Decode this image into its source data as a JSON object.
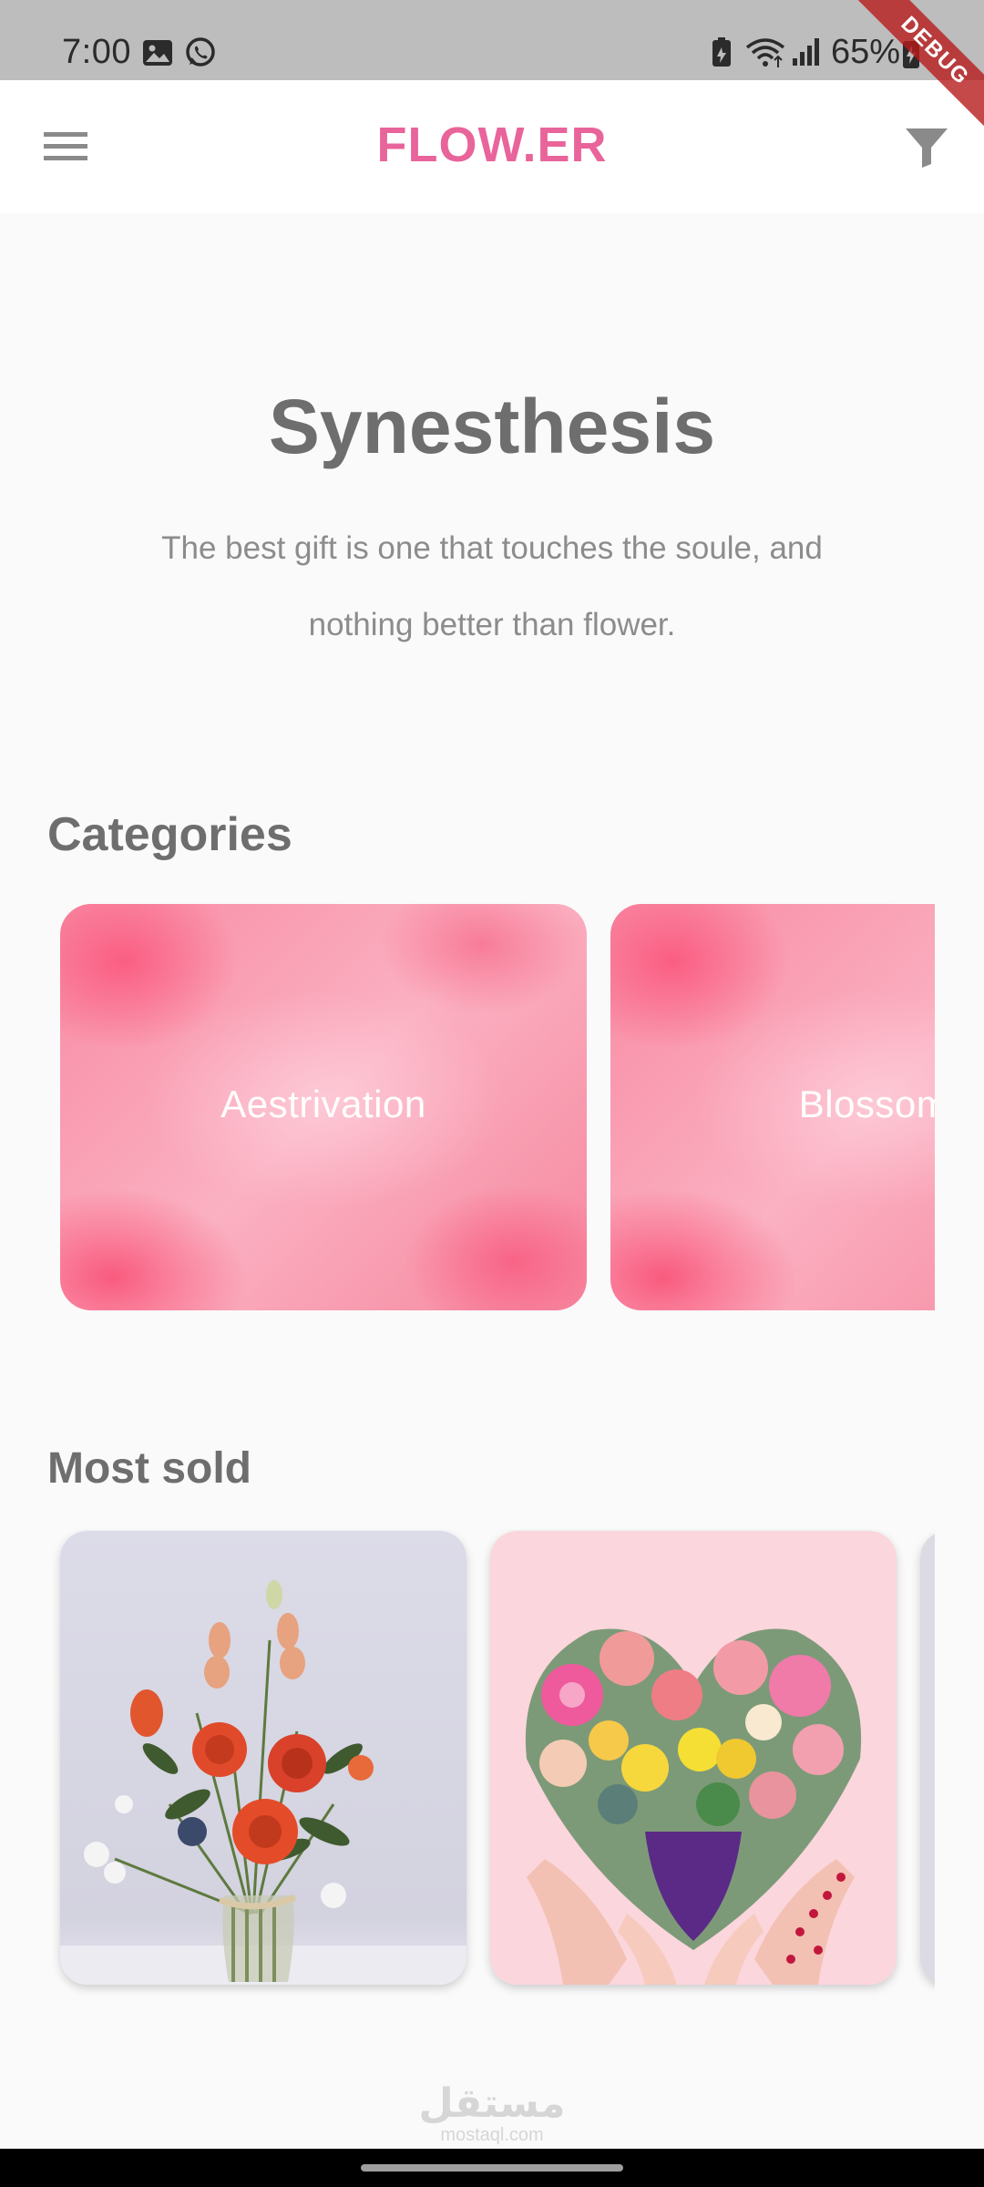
{
  "status_bar": {
    "time": "7:00",
    "battery": "65%",
    "icons": [
      "gallery-icon",
      "whatsapp-icon",
      "battery-saver-icon",
      "wifi-icon",
      "signal-icon",
      "charging-icon"
    ]
  },
  "debug_banner": "DEBUG",
  "app_bar": {
    "title": "FLOW.ER",
    "title_color": "#e8649a",
    "menu_icon": "hamburger-menu-icon",
    "filter_icon": "filter-icon"
  },
  "hero": {
    "title": "Synesthesis",
    "subtitle": "The best gift is one that touches the soule, and nothing better than flower."
  },
  "categories": {
    "title": "Categories",
    "items": [
      {
        "label": "Aestrivation"
      },
      {
        "label": "Blossom"
      }
    ]
  },
  "most_sold": {
    "title": "Most sold",
    "items": [
      {
        "image": "flower-bouquet-in-glass-vase"
      },
      {
        "image": "heart-shaped-flower-bouquet-in-hands"
      },
      {
        "image": "partially-visible-product"
      }
    ]
  },
  "watermark": {
    "main": "مستقل",
    "sub": "mostaql.com"
  }
}
